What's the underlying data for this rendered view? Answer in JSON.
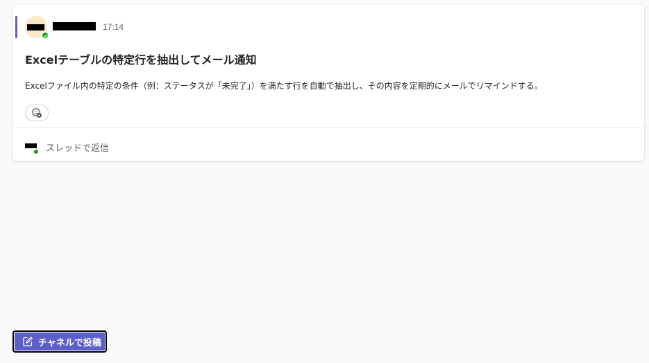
{
  "post": {
    "time": "17:14",
    "title": "Excelテーブルの特定行を抽出してメール通知",
    "body": "Excelファイル内の特定の条件（例：ステータスが「未完了」）を満たす行を自動で抽出し、その内容を定期的にメールでリマインドする。",
    "reaction_icon": "add-reaction-icon",
    "reply_label": "スレッドで返信"
  },
  "footer": {
    "new_post_label": "チャネルで投稿",
    "new_post_icon": "compose-icon"
  },
  "colors": {
    "accent": "#5b5fc7",
    "presence_available": "#13a10e",
    "avatar_background": "#fbe7c8"
  }
}
